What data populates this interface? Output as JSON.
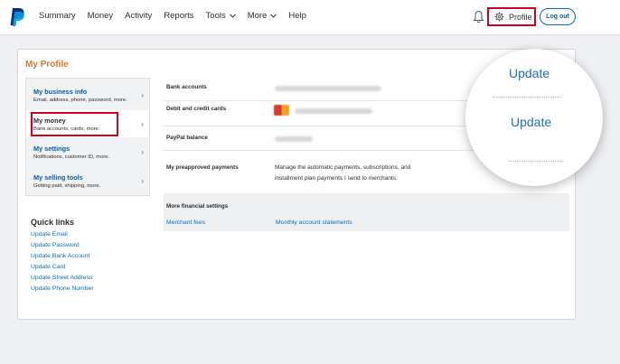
{
  "nav": {
    "items": [
      {
        "label": "Summary",
        "dropdown": false
      },
      {
        "label": "Money",
        "dropdown": false
      },
      {
        "label": "Activity",
        "dropdown": false
      },
      {
        "label": "Reports",
        "dropdown": false
      },
      {
        "label": "Tools",
        "dropdown": true
      },
      {
        "label": "More",
        "dropdown": true
      },
      {
        "label": "Help",
        "dropdown": false
      }
    ],
    "profile_label": "Profile",
    "logout_label": "Log out"
  },
  "colors": {
    "brand_blue": "#0070ba",
    "highlight_red": "#d0021b",
    "title_orange": "#d97732"
  },
  "card": {
    "title": "My Profile"
  },
  "sidebar": {
    "items": [
      {
        "title": "My business info",
        "desc": "Email, address, phone, password, more."
      },
      {
        "title": "My money",
        "desc": "Bank accounts, cards, more."
      },
      {
        "title": "My settings",
        "desc": "Notifications, customer ID, more."
      },
      {
        "title": "My selling tools",
        "desc": "Getting paid, shipping, more."
      }
    ]
  },
  "quick_links": {
    "title": "Quick links",
    "links": [
      "Update Email",
      "Update Password",
      "Update Bank Account",
      "Update Card",
      "Update Street Address",
      "Update Phone Number"
    ]
  },
  "money_rows": [
    {
      "label": "Bank accounts"
    },
    {
      "label": "Debit and credit cards"
    },
    {
      "label": "PayPal balance"
    },
    {
      "label": "My preapproved payments",
      "value": "Manage the automatic payments, subscriptions, and installment plan payments I send to merchants."
    }
  ],
  "more_financial": {
    "label": "More financial settings",
    "links": [
      "Merchant fees",
      "Monthly account statements"
    ]
  },
  "magnifier": {
    "update_top": "Update",
    "update_main": "Update"
  }
}
